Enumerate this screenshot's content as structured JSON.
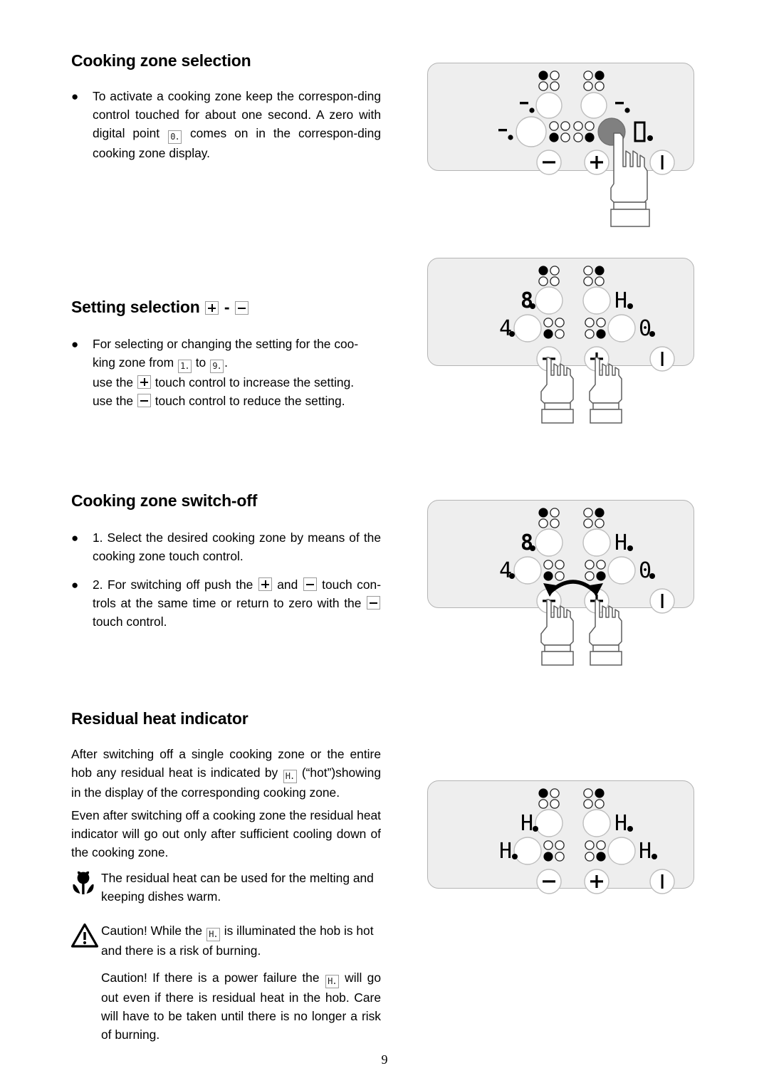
{
  "page": {
    "number": "9",
    "language": "en"
  },
  "sections": [
    {
      "id": "cooking-zone-selection",
      "title": "Cooking zone selection",
      "bullets": [
        {
          "parts": [
            {
              "t": "text",
              "v": "To activate a cooking zone keep the correspon-ding control touched for about one second. A zero with digital point "
            },
            {
              "t": "glyph",
              "v": "0."
            },
            {
              "t": "text",
              "v": " comes on in the correspon-ding cooking zone display."
            }
          ]
        }
      ]
    },
    {
      "id": "setting-selection",
      "title": "Setting selection",
      "title_icons": [
        "plus",
        "hyphen",
        "minus"
      ],
      "bullets": [
        {
          "parts": [
            {
              "t": "text",
              "v": "For selecting or changing the setting for the coo-king zone from "
            },
            {
              "t": "glyph",
              "v": "1."
            },
            {
              "t": "text",
              "v": " to "
            },
            {
              "t": "glyph",
              "v": "9."
            },
            {
              "t": "text",
              "v": "."
            }
          ]
        }
      ],
      "lines": [
        {
          "parts": [
            {
              "t": "text",
              "v": "use the "
            },
            {
              "t": "boxicon",
              "v": "plus"
            },
            {
              "t": "text",
              "v": " touch control to increase the setting."
            }
          ]
        },
        {
          "parts": [
            {
              "t": "text",
              "v": "use the "
            },
            {
              "t": "boxicon",
              "v": "minus"
            },
            {
              "t": "text",
              "v": " touch control to reduce the setting."
            }
          ]
        }
      ]
    },
    {
      "id": "cooking-zone-switch-off",
      "title": "Cooking zone switch-off",
      "bullets": [
        {
          "parts": [
            {
              "t": "text",
              "v": "1. Select the desired cooking zone by means of the cooking zone touch control."
            }
          ]
        },
        {
          "parts": [
            {
              "t": "text",
              "v": "2. For switching off push the "
            },
            {
              "t": "boxicon",
              "v": "plus"
            },
            {
              "t": "text",
              "v": " and "
            },
            {
              "t": "boxicon",
              "v": "minus"
            },
            {
              "t": "text",
              "v": " touch con-trols at the same time or return to zero with the "
            },
            {
              "t": "boxicon",
              "v": "minus"
            },
            {
              "t": "text",
              "v": " touch control."
            }
          ]
        }
      ]
    },
    {
      "id": "residual-heat-indicator",
      "title": "Residual heat indicator",
      "paragraphs": [
        {
          "id": "para-residual-1",
          "parts": [
            {
              "t": "text",
              "v": "After switching off a single cooking zone or the entire hob any residual heat is indicated by "
            },
            {
              "t": "glyph",
              "v": "H."
            },
            {
              "t": "text",
              "v": " (“hot”)showing in the display of the corresponding cooking zone."
            }
          ]
        },
        {
          "id": "para-residual-2",
          "parts": [
            {
              "t": "text",
              "v": "Even after switching off a cooking zone the residual heat indicator will go out only after sufficient cooling down of the cooking zone."
            }
          ]
        }
      ],
      "notes": [
        {
          "id": "note-tip",
          "icon": "flower-icon",
          "parts": [
            {
              "t": "text",
              "v": "The residual heat can be used for the melting and keeping dishes warm."
            }
          ]
        },
        {
          "id": "note-caution-hot",
          "icon": "warning-triangle-icon",
          "parts": [
            {
              "t": "text",
              "v": "Caution! While the "
            },
            {
              "t": "glyph",
              "v": "H."
            },
            {
              "t": "text",
              "v": " is illuminated the hob is hot and there is a risk of burning."
            }
          ]
        },
        {
          "id": "note-caution-power",
          "icon": "none",
          "parts": [
            {
              "t": "text",
              "v": "Caution! If there is a power failure the "
            },
            {
              "t": "glyph",
              "v": "H."
            },
            {
              "t": "text",
              "v": " will go out even if there is residual heat in the hob. Care will have to be taken until there is no longer a risk of burning."
            }
          ]
        }
      ]
    }
  ],
  "diagrams": [
    {
      "id": "diagram-zone-selection",
      "caption_none": "",
      "displays": {
        "rear_left": "-.",
        "rear_right": "-.",
        "front_left": "-.",
        "front_right": "0."
      },
      "highlighted_zone": "front-right",
      "hands": [
        "front-right-zone"
      ],
      "arrow": "none",
      "buttons": {
        "minus": "−",
        "plus": "+",
        "onoff": "|"
      }
    },
    {
      "id": "diagram-setting-selection",
      "displays": {
        "rear_left": "8.",
        "rear_right": "H.",
        "front_left": "4.",
        "front_right": "0."
      },
      "highlighted_zone": "none",
      "hands": [
        "minus-button",
        "plus-button"
      ],
      "arrow": "none",
      "buttons": {
        "minus": "−",
        "plus": "+",
        "onoff": "|"
      }
    },
    {
      "id": "diagram-switch-off",
      "displays": {
        "rear_left": "8.",
        "rear_right": "H.",
        "front_left": "4.",
        "front_right": "0."
      },
      "highlighted_zone": "none",
      "hands": [
        "minus-button",
        "plus-button"
      ],
      "arrow": "double-headed-curved",
      "buttons": {
        "minus": "−",
        "plus": "+",
        "onoff": "|"
      }
    },
    {
      "id": "diagram-residual-heat",
      "displays": {
        "rear_left": "H.",
        "rear_right": "H.",
        "front_left": "H.",
        "front_right": "H."
      },
      "highlighted_zone": "none",
      "hands": [],
      "arrow": "none",
      "buttons": {
        "minus": "−",
        "plus": "+",
        "onoff": "|"
      }
    }
  ],
  "colors": {
    "panel_fill": "#eeeeee",
    "panel_border": "#b4b4b4",
    "zone_button_fill": "#ffffff",
    "zone_button_highlight": "#808080",
    "text": "#000000"
  }
}
